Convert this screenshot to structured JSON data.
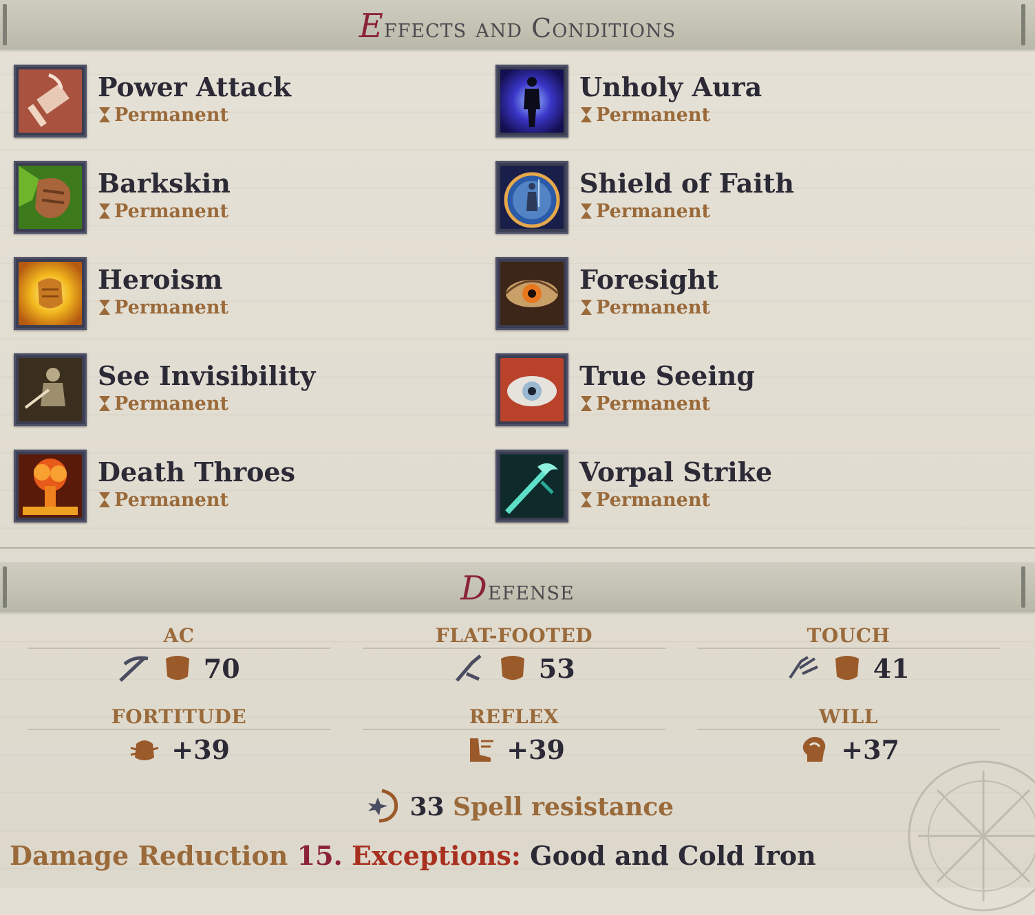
{
  "effects_header": {
    "initial": "E",
    "rest": "ffects and Conditions"
  },
  "effects": [
    {
      "name": "Power Attack",
      "duration": "Permanent",
      "icon": "hammer-icon"
    },
    {
      "name": "Unholy Aura",
      "duration": "Permanent",
      "icon": "dark-figure-icon"
    },
    {
      "name": "Barkskin",
      "duration": "Permanent",
      "icon": "bark-fist-icon"
    },
    {
      "name": "Shield of Faith",
      "duration": "Permanent",
      "icon": "faith-shield-icon"
    },
    {
      "name": "Heroism",
      "duration": "Permanent",
      "icon": "glowing-fist-icon"
    },
    {
      "name": "Foresight",
      "duration": "Permanent",
      "icon": "golden-eye-icon"
    },
    {
      "name": "See Invisibility",
      "duration": "Permanent",
      "icon": "ghost-knight-icon"
    },
    {
      "name": "True Seeing",
      "duration": "Permanent",
      "icon": "red-eye-icon"
    },
    {
      "name": "Death Throes",
      "duration": "Permanent",
      "icon": "explosion-icon"
    },
    {
      "name": "Vorpal Strike",
      "duration": "Permanent",
      "icon": "vorpal-sword-icon"
    }
  ],
  "defense_header": {
    "initial": "D",
    "rest": "efense"
  },
  "defense": {
    "ac": {
      "label": "AC",
      "value": "70"
    },
    "flat_footed": {
      "label": "FLAT-FOOTED",
      "value": "53"
    },
    "touch": {
      "label": "TOUCH",
      "value": "41"
    },
    "fortitude": {
      "label": "FORTITUDE",
      "value": "+39"
    },
    "reflex": {
      "label": "REFLEX",
      "value": "+39"
    },
    "will": {
      "label": "WILL",
      "value": "+37"
    }
  },
  "spell_resistance": {
    "value": "33",
    "label": "Spell resistance"
  },
  "damage_reduction": {
    "label": "Damage Reduction",
    "value": "15.",
    "exceptions_label": "Exceptions:",
    "exceptions_value": "Good and Cold Iron"
  }
}
